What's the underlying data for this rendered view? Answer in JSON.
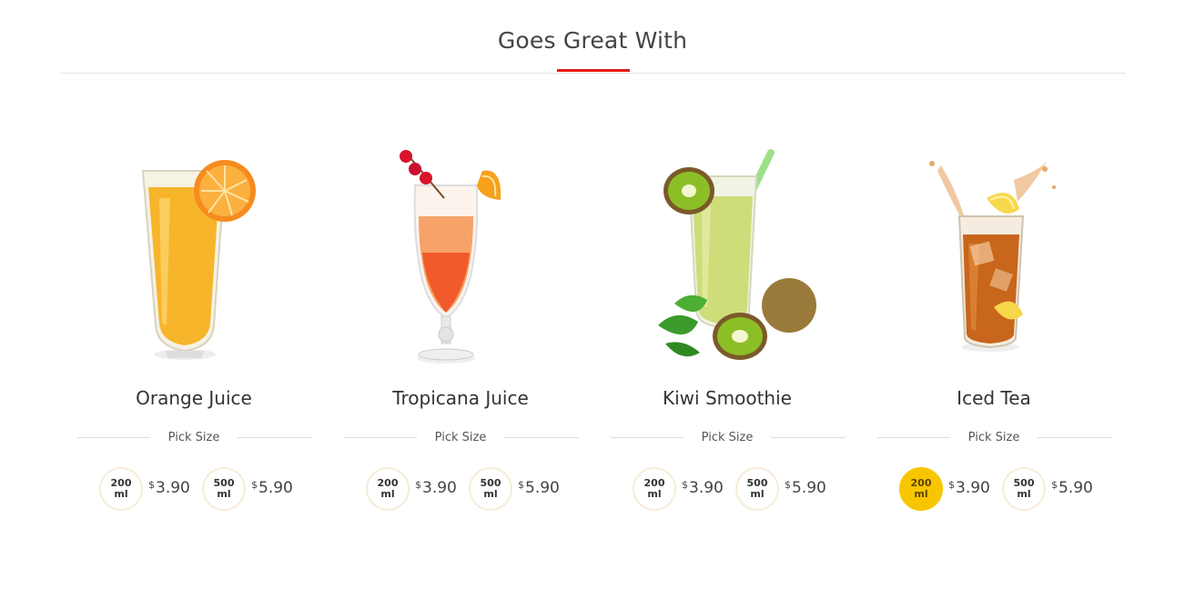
{
  "section": {
    "title": "Goes Great With"
  },
  "products": [
    {
      "name": "Orange Juice",
      "image_icon": "orange-juice-glass",
      "pick_size_label": "Pick Size",
      "sizes": [
        {
          "volume": "200",
          "unit": "ml",
          "currency": "$",
          "price": "3.90",
          "selected": false
        },
        {
          "volume": "500",
          "unit": "ml",
          "currency": "$",
          "price": "5.90",
          "selected": false
        }
      ]
    },
    {
      "name": "Tropicana Juice",
      "image_icon": "tropicana-cocktail-glass",
      "pick_size_label": "Pick Size",
      "sizes": [
        {
          "volume": "200",
          "unit": "ml",
          "currency": "$",
          "price": "3.90",
          "selected": false
        },
        {
          "volume": "500",
          "unit": "ml",
          "currency": "$",
          "price": "5.90",
          "selected": false
        }
      ]
    },
    {
      "name": "Kiwi Smoothie",
      "image_icon": "kiwi-smoothie-glass",
      "pick_size_label": "Pick Size",
      "sizes": [
        {
          "volume": "200",
          "unit": "ml",
          "currency": "$",
          "price": "3.90",
          "selected": false
        },
        {
          "volume": "500",
          "unit": "ml",
          "currency": "$",
          "price": "5.90",
          "selected": false
        }
      ]
    },
    {
      "name": "Iced Tea",
      "image_icon": "iced-tea-glass",
      "pick_size_label": "Pick Size",
      "sizes": [
        {
          "volume": "200",
          "unit": "ml",
          "currency": "$",
          "price": "3.90",
          "selected": true
        },
        {
          "volume": "500",
          "unit": "ml",
          "currency": "$",
          "price": "5.90",
          "selected": false
        }
      ]
    }
  ],
  "colors": {
    "accent": "#e41b17",
    "selected_size": "#f7c600",
    "size_border": "#f7ecd8"
  }
}
